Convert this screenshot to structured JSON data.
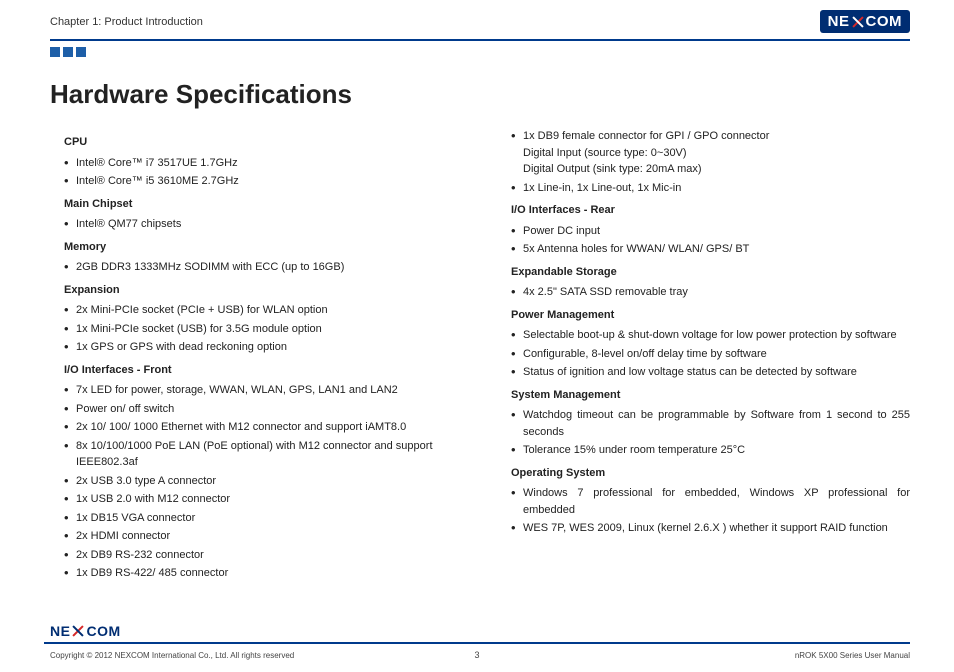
{
  "header": {
    "chapter": "Chapter 1: Product Introduction",
    "brand_left": "NE",
    "brand_right": "COM"
  },
  "title": "Hardware Specifications",
  "left": {
    "s1": {
      "title": "CPU",
      "items": [
        "Intel® Core™ i7 3517UE 1.7GHz",
        "Intel® Core™ i5 3610ME 2.7GHz"
      ]
    },
    "s2": {
      "title": "Main Chipset",
      "items": [
        "Intel® QM77 chipsets"
      ]
    },
    "s3": {
      "title": "Memory",
      "items": [
        "2GB DDR3 1333MHz SODIMM with ECC (up to 16GB)"
      ]
    },
    "s4": {
      "title": "Expansion",
      "items": [
        "2x Mini-PCIe socket (PCIe + USB) for WLAN option",
        "1x Mini-PCIe socket (USB) for 3.5G module option",
        "1x GPS or GPS with dead reckoning option"
      ]
    },
    "s5": {
      "title": "I/O Interfaces - Front",
      "items": [
        "7x LED for power, storage, WWAN, WLAN, GPS, LAN1 and LAN2",
        "Power on/ off switch",
        "2x 10/ 100/ 1000 Ethernet with M12 connector and support iAMT8.0",
        "8x 10/100/1000 PoE LAN (PoE optional) with M12 connector and support IEEE802.3af",
        "2x USB 3.0 type A connector",
        "1x USB 2.0 with M12 connector",
        "1x DB15 VGA connector",
        "2x HDMI connector",
        "2x DB9 RS-232 connector",
        "1x DB9 RS-422/ 485 connector"
      ]
    }
  },
  "right": {
    "top_items": [
      "1x DB9 female connector for GPI / GPO connector\nDigital Input (source type: 0~30V)\nDigital Output (sink type: 20mA max)",
      "1x Line-in, 1x Line-out, 1x Mic-in"
    ],
    "s1": {
      "title": "I/O Interfaces - Rear",
      "items": [
        "Power DC input",
        "5x Antenna holes for WWAN/ WLAN/ GPS/ BT"
      ]
    },
    "s2": {
      "title": "Expandable Storage",
      "items": [
        "4x 2.5\" SATA SSD removable tray"
      ]
    },
    "s3": {
      "title": "Power Management",
      "items": [
        "Selectable boot-up & shut-down voltage for low power protection by software",
        "Configurable, 8-level on/off delay time by software",
        "Status of ignition and low voltage status can be detected by software"
      ]
    },
    "s4": {
      "title": "System Management",
      "items": [
        "Watchdog timeout can be programmable by Software from 1 second to 255 seconds",
        "Tolerance 15% under room temperature 25°C"
      ]
    },
    "s5": {
      "title": "Operating System",
      "items": [
        "Windows 7 professional for embedded, Windows XP professional for embedded",
        "WES 7P, WES 2009, Linux (kernel 2.6.X ) whether it support RAID function"
      ]
    }
  },
  "footer": {
    "copyright": "Copyright © 2012 NEXCOM International Co., Ltd. All rights reserved",
    "page": "3",
    "manual": "nROK 5X00 Series User Manual"
  }
}
